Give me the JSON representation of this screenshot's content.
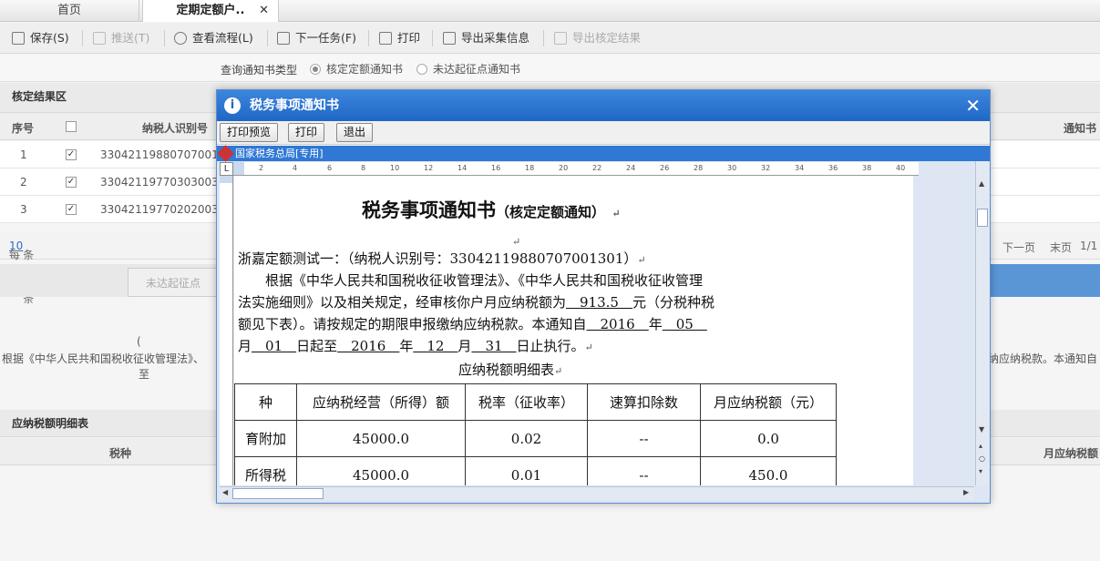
{
  "tabs": {
    "home": "首页",
    "active": "定期定额户..",
    "close": "✕"
  },
  "toolbar": {
    "save": "保存(S)",
    "push": "推送(T)",
    "view_flow": "查看流程(L)",
    "next_task": "下一任务(F)",
    "print": "打印",
    "export_collect": "导出采集信息",
    "export_result": "导出核定结果"
  },
  "filter": {
    "label": "查询通知书类型",
    "opt1": "核定定额通知书",
    "opt2": "未达起征点通知书"
  },
  "result_section": {
    "title": "核定结果区",
    "col_no": "序号",
    "col_taxpayer": "纳税人识别号",
    "col_notice": "通知书"
  },
  "rows": [
    {
      "no": "1",
      "id": "330421198807070013"
    },
    {
      "no": "2",
      "id": "330421197703030031"
    },
    {
      "no": "3",
      "id": "330421197702020031"
    }
  ],
  "pager": {
    "prefix": "每页",
    "size": "10",
    "suffix": "条 共3条",
    "next": "下一页",
    "last": "末页",
    "page": "1/1"
  },
  "subtab": "未达起征点",
  "bg_text": {
    "paren": "(",
    "law": "根据《中华人民共和国税收征收管理法》、",
    "to": "至",
    "right": "纳应纳税款。本通知自"
  },
  "detail_section": {
    "title": "应纳税额明细表",
    "col_tax": "税种",
    "col_monthly": "月应纳税额"
  },
  "modal": {
    "title": "税务事项通知书",
    "close": "✕",
    "btn_preview": "打印预览",
    "btn_print": "打印",
    "btn_exit": "退出",
    "viewer_header": "国家税务总局[专用]"
  },
  "doc": {
    "title": "税务事项通知书",
    "subtitle": "（核定定额通知）",
    "mark": "↵",
    "p1": "浙嘉定额测试一：（纳税人识别号：330421198807070013 01）",
    "p1_text": "浙嘉定额测试一：（纳税人识别号：330421198807070013 01）",
    "addr": "浙嘉定额测试一：（纳税人识别号：330421198807070013 01）",
    "line1": "浙嘉定额测试一：（纳税人识别号：",
    "line1_id": "33042119880707001301",
    "line1_end": "）",
    "line2": "　　根据《中华人民共和国税收征收管理法》、《中华人民共和国税收征收管理",
    "line3_a": "法实施细则》以及相关规定，经审核你户月应纳税额为",
    "line3_amt": "　913.5　",
    "line3_b": "元（分税种税",
    "line4_a": "额见下表）。请按规定的期限申报缴纳应纳税款。本通知自",
    "line4_y": "　2016　",
    "line4_b": "年",
    "line4_m": "　05　",
    "line5_a": "月",
    "line5_d": "　01　",
    "line5_b": "日起至",
    "line5_y": "　2016　",
    "line5_c": "年",
    "line5_m": "　12　",
    "line5_d2": "月",
    "line5_dd": "　31　",
    "line5_e": "日止执行。",
    "table_title": "应纳税额明细表",
    "th": [
      "种",
      "应纳税经营（所得）额",
      "税率（征收率）",
      "速算扣除数",
      "月应纳税额（元）"
    ],
    "tr1": [
      "育附加",
      "45000.0",
      "0.02",
      "--",
      "0.0"
    ],
    "tr2": [
      "所得税",
      "45000.0",
      "0.01",
      "--",
      "450.0"
    ]
  }
}
